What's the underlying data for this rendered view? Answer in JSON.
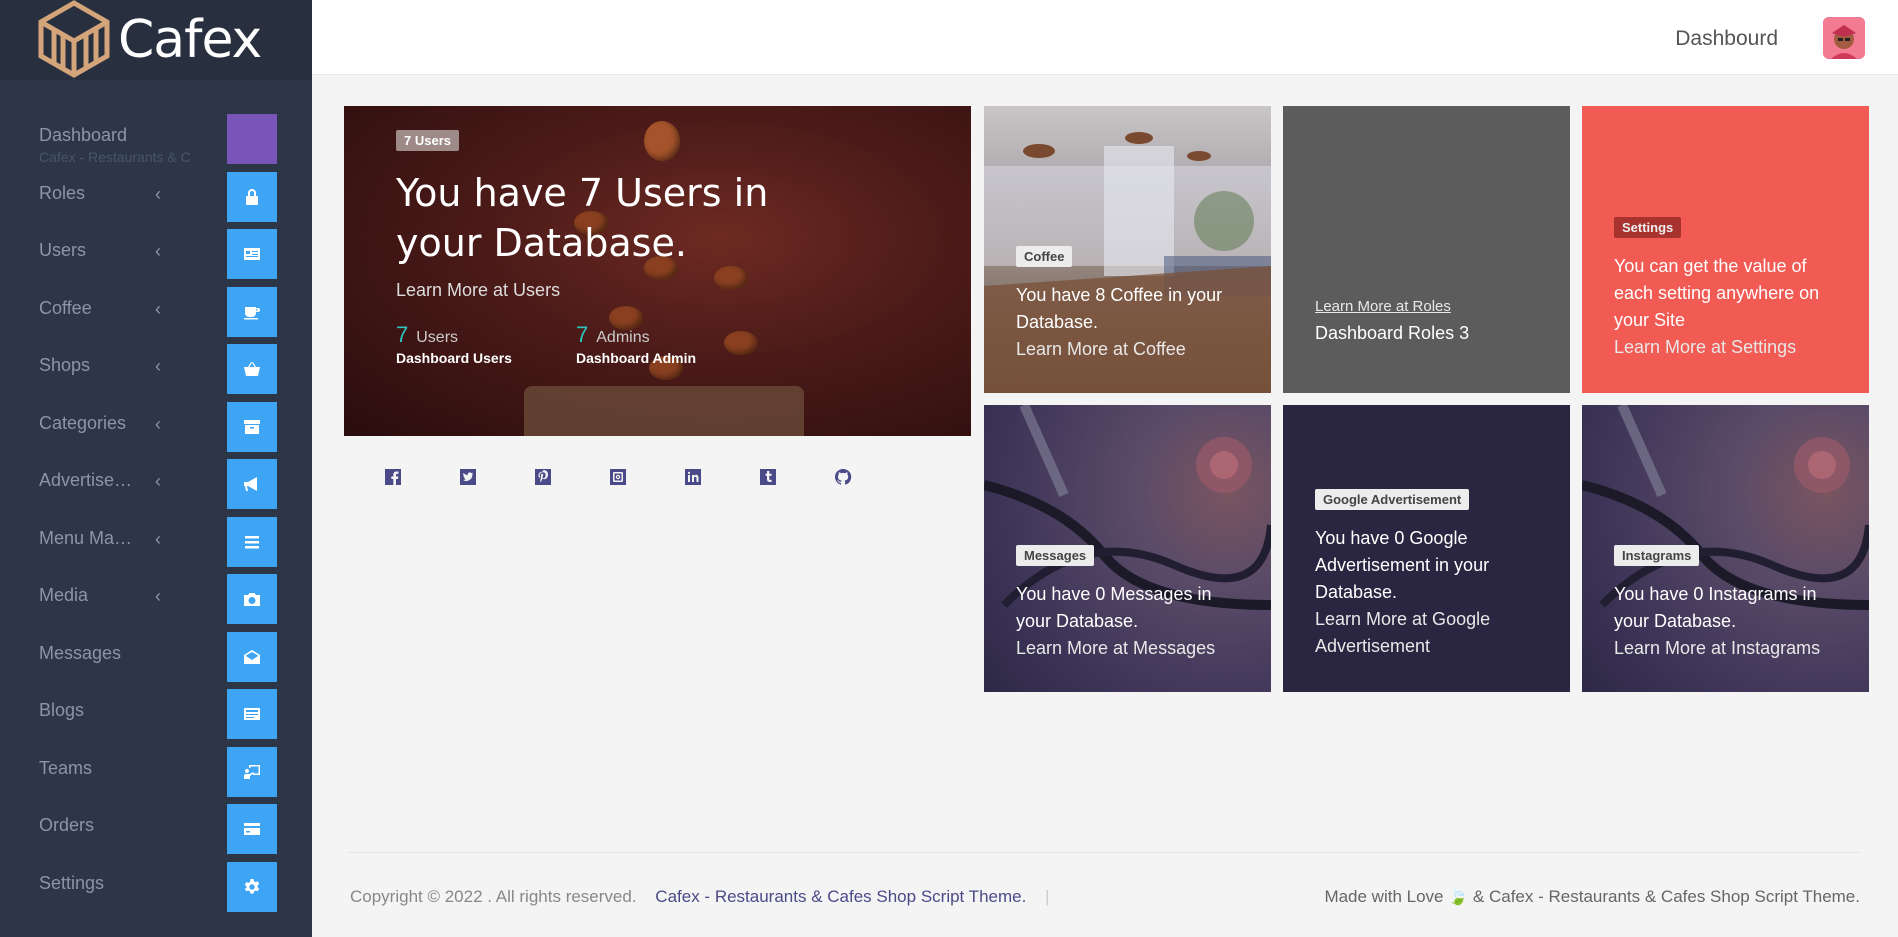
{
  "brand": {
    "name": "Cafex"
  },
  "header": {
    "title": "Dashbourd"
  },
  "sidebar": {
    "items": [
      {
        "label": "Dashboard",
        "sub": "Cafex - Restaurants & C",
        "chevron": "",
        "icon": "square-icon"
      },
      {
        "label": "Roles",
        "chevron": "‹",
        "icon": "lock-icon"
      },
      {
        "label": "Users",
        "chevron": "‹",
        "icon": "id-card-icon"
      },
      {
        "label": "Coffee",
        "chevron": "‹",
        "icon": "coffee-icon"
      },
      {
        "label": "Shops",
        "chevron": "‹",
        "icon": "basket-icon"
      },
      {
        "label": "Categories",
        "chevron": "‹",
        "icon": "archive-icon"
      },
      {
        "label": "Advertise…",
        "chevron": "‹",
        "icon": "megaphone-icon"
      },
      {
        "label": "Menu Maker",
        "chevron": "‹",
        "icon": "menu-icon"
      },
      {
        "label": "Media",
        "chevron": "‹",
        "icon": "camera-icon"
      },
      {
        "label": "Messages",
        "chevron": "",
        "icon": "envelope-icon"
      },
      {
        "label": "Blogs",
        "chevron": "",
        "icon": "newspaper-icon"
      },
      {
        "label": "Teams",
        "chevron": "",
        "icon": "presentation-icon"
      },
      {
        "label": "Orders",
        "chevron": "",
        "icon": "credit-card-icon"
      },
      {
        "label": "Settings",
        "chevron": "",
        "icon": "gear-icon"
      }
    ]
  },
  "hero": {
    "badge": "7 Users",
    "title": "You have 7 Users in your Database.",
    "link": "Learn More at Users",
    "stats": [
      {
        "num": "7",
        "label": "Users",
        "sub": "Dashboard Users"
      },
      {
        "num": "7",
        "label": "Admins",
        "sub": "Dashboard Admin"
      }
    ]
  },
  "social": [
    "facebook-icon",
    "twitter-icon",
    "pinterest-icon",
    "instagram-icon",
    "linkedin-icon",
    "tumblr-icon",
    "github-icon"
  ],
  "tiles": {
    "coffee": {
      "badge": "Coffee",
      "text": "You have 8 Coffee in your Database.",
      "link": "Learn More at Coffee"
    },
    "roles": {
      "link": "Learn More at Roles",
      "text": "Dashboard Roles 3"
    },
    "settings": {
      "badge": "Settings",
      "text": "You can get the value of each setting anywhere on your Site",
      "link": "Learn More at Settings"
    },
    "messages": {
      "badge": "Messages",
      "text": "You have 0 Messages in your Database.",
      "link": "Learn More at Messages"
    },
    "google": {
      "badge": "Google Advertisement",
      "text": "You have 0 Google Advertisement in your Database.",
      "link": "Learn More at Google Advertisement"
    },
    "instagrams": {
      "badge": "Instagrams",
      "text": "You have 0 Instagrams in your Database.",
      "link": "Learn More at Instagrams"
    }
  },
  "footer": {
    "copyright": "Copyright © 2022 . All rights reserved.",
    "brand_link": "Cafex - Restaurants & Cafes Shop Script Theme.",
    "separator": "|",
    "made_with": "Made with Love",
    "leaf": "🍃",
    "theme": "& Cafex - Restaurants & Cafes Shop Script Theme."
  },
  "colors": {
    "sidebar": "#2d3646",
    "accent": "#3da5f4",
    "settings_tile": "#f25a54",
    "roles_tile": "#5c5c5c",
    "brand_link": "#4b4a88"
  }
}
